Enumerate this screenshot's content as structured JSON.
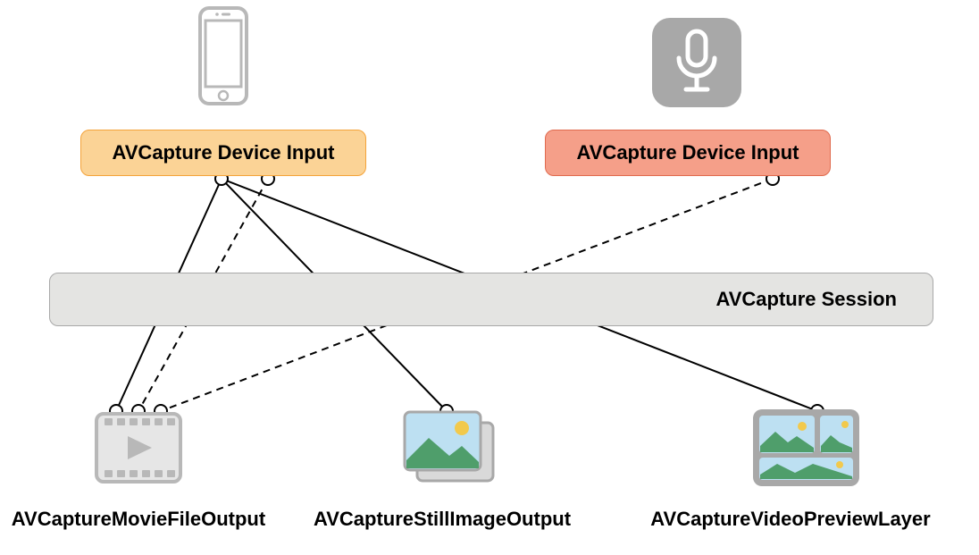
{
  "inputs": {
    "left": {
      "label": "AVCapture Device Input",
      "fill": "#fbd396",
      "border": "#f4a33a"
    },
    "right": {
      "label": "AVCapture Device Input",
      "fill": "#f59f89",
      "border": "#e06a4e"
    }
  },
  "session": {
    "label": "AVCapture Session"
  },
  "outputs": {
    "movie": {
      "label": "AVCaptureMovieFileOutput"
    },
    "still": {
      "label": "AVCaptureStillImageOutput"
    },
    "preview": {
      "label": "AVCaptureVideoPreviewLayer"
    }
  },
  "icons": {
    "phone": "phone-icon",
    "mic": "microphone-icon",
    "film": "film-strip-icon",
    "photo": "photo-stack-icon",
    "grid": "preview-grid-icon"
  },
  "connections": [
    {
      "from": "input-left",
      "to": "movie",
      "style": "solid",
      "fromPort": 0,
      "toPort": 0
    },
    {
      "from": "input-left",
      "to": "movie",
      "style": "dashed",
      "fromPort": 1,
      "toPort": 1
    },
    {
      "from": "input-left",
      "to": "still",
      "style": "solid",
      "fromPort": 0,
      "toPort": 0
    },
    {
      "from": "input-left",
      "to": "preview",
      "style": "solid",
      "fromPort": 0,
      "toPort": 0
    },
    {
      "from": "input-right",
      "to": "movie",
      "style": "dashed",
      "fromPort": 0,
      "toPort": 2
    }
  ]
}
